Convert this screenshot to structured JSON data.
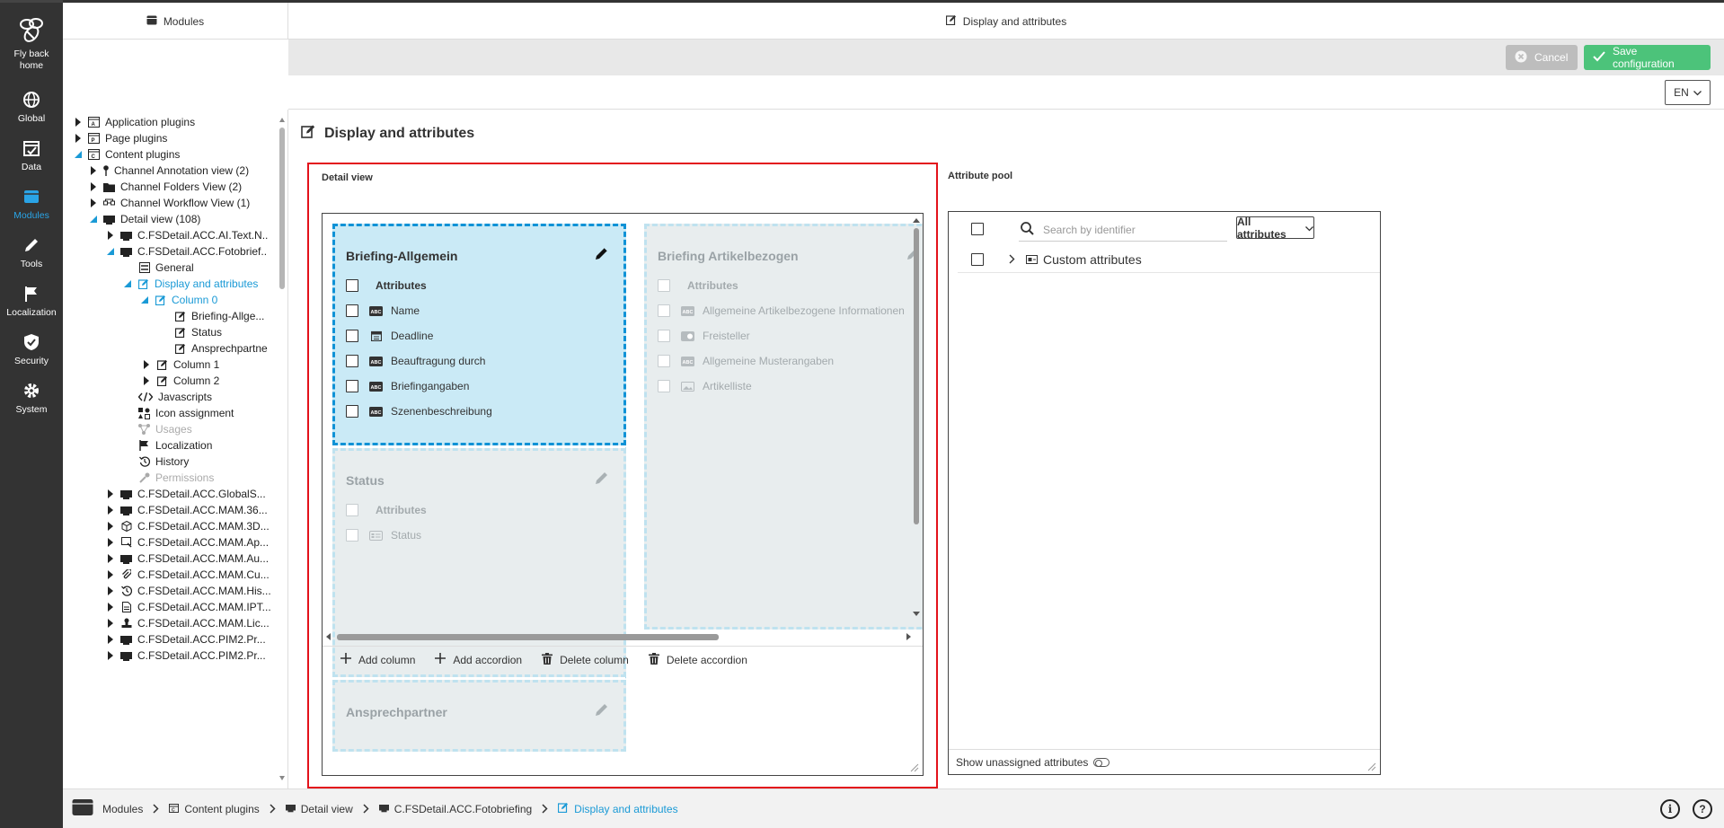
{
  "sidebar": {
    "home_label": "Fly back home",
    "items": [
      {
        "label": "Global",
        "icon": "globe-icon"
      },
      {
        "label": "Data",
        "icon": "calendar-icon"
      },
      {
        "label": "Modules",
        "icon": "modules-icon"
      },
      {
        "label": "Tools",
        "icon": "pencil-icon"
      },
      {
        "label": "Localization",
        "icon": "flag-icon"
      },
      {
        "label": "Security",
        "icon": "shield-icon"
      },
      {
        "label": "System",
        "icon": "gear-icon"
      }
    ],
    "active_color": "#2aa4e6"
  },
  "topbar": {
    "left_title": "Modules",
    "right_title": "Display and attributes"
  },
  "actions": {
    "cancel": "Cancel",
    "save": "Save configuration"
  },
  "lang": "EN",
  "tree": [
    {
      "label": "Application plugins"
    },
    {
      "label": "Page plugins"
    },
    {
      "label": "Content plugins"
    },
    {
      "label": "Channel Annotation view (2)"
    },
    {
      "label": "Channel Folders View (2)"
    },
    {
      "label": "Channel Workflow View (1)"
    },
    {
      "label": "Detail view (108)"
    },
    {
      "label": "C.FSDetail.ACC.AI.Text.N.."
    },
    {
      "label": "C.FSDetail.ACC.Fotobrief.."
    },
    {
      "label": "General"
    },
    {
      "label": "Display and attributes"
    },
    {
      "label": "Column 0"
    },
    {
      "label": "Briefing-Allge..."
    },
    {
      "label": "Status"
    },
    {
      "label": "Ansprechpartne"
    },
    {
      "label": "Column 1"
    },
    {
      "label": "Column 2"
    },
    {
      "label": "Javascripts"
    },
    {
      "label": "Icon assignment"
    },
    {
      "label": "Usages"
    },
    {
      "label": "Localization"
    },
    {
      "label": "History"
    },
    {
      "label": "Permissions"
    },
    {
      "label": "C.FSDetail.ACC.GlobalS..."
    },
    {
      "label": "C.FSDetail.ACC.MAM.36..."
    },
    {
      "label": "C.FSDetail.ACC.MAM.3D..."
    },
    {
      "label": "C.FSDetail.ACC.MAM.Ap..."
    },
    {
      "label": "C.FSDetail.ACC.MAM.Au..."
    },
    {
      "label": "C.FSDetail.ACC.MAM.Cu..."
    },
    {
      "label": "C.FSDetail.ACC.MAM.His..."
    },
    {
      "label": "C.FSDetail.ACC.MAM.IPT..."
    },
    {
      "label": "C.FSDetail.ACC.MAM.Lic..."
    },
    {
      "label": "C.FSDetail.ACC.PIM2.Pr..."
    },
    {
      "label": "C.FSDetail.ACC.PIM2.Pr..."
    }
  ],
  "page": {
    "title": "Display and attributes"
  },
  "detail_view": {
    "label": "Detail view",
    "columns": [
      {
        "accordions": [
          {
            "title": "Briefing-Allgemein",
            "header": "Attributes",
            "rows": [
              {
                "label": "Name",
                "icon": "text-abc-icon"
              },
              {
                "label": "Deadline",
                "icon": "date-icon"
              },
              {
                "label": "Beauftragung durch",
                "icon": "text-abc-icon"
              },
              {
                "label": "Briefingangaben",
                "icon": "text-abc-icon"
              },
              {
                "label": "Szenenbeschreibung",
                "icon": "text-abc-icon"
              }
            ]
          },
          {
            "title": "Status",
            "header": "Attributes",
            "rows": [
              {
                "label": "Status",
                "icon": "list-icon"
              }
            ]
          },
          {
            "title": "Ansprechpartner"
          }
        ]
      },
      {
        "accordions": [
          {
            "title": "Briefing Artikelbezogen",
            "header": "Attributes",
            "rows": [
              {
                "label": "Allgemeine Artikelbezogene Informationen",
                "icon": "text-abc-icon"
              },
              {
                "label": "Freisteller",
                "icon": "toggle-icon"
              },
              {
                "label": "Allgemeine Musterangaben",
                "icon": "text-abc-icon"
              },
              {
                "label": "Artikelliste",
                "icon": "image-icon"
              }
            ]
          }
        ]
      }
    ],
    "footer": {
      "add_column": "Add column",
      "add_accordion": "Add accordion",
      "delete_column": "Delete column",
      "delete_accordion": "Delete accordion"
    }
  },
  "attribute_pool": {
    "label": "Attribute pool",
    "search_placeholder": "Search by identifier",
    "filter": "All attributes",
    "rows": [
      {
        "label": "Custom attributes"
      }
    ],
    "show_unassigned": "Show unassigned attributes"
  },
  "breadcrumb": [
    {
      "label": "Modules"
    },
    {
      "label": "Content plugins"
    },
    {
      "label": "Detail view"
    },
    {
      "label": "C.FSDetail.ACC.Fotobriefing"
    },
    {
      "label": "Display and attributes"
    }
  ],
  "colors": {
    "accent": "#1a9ad6",
    "save": "#4cc37a",
    "highlight": "#e3121b"
  }
}
